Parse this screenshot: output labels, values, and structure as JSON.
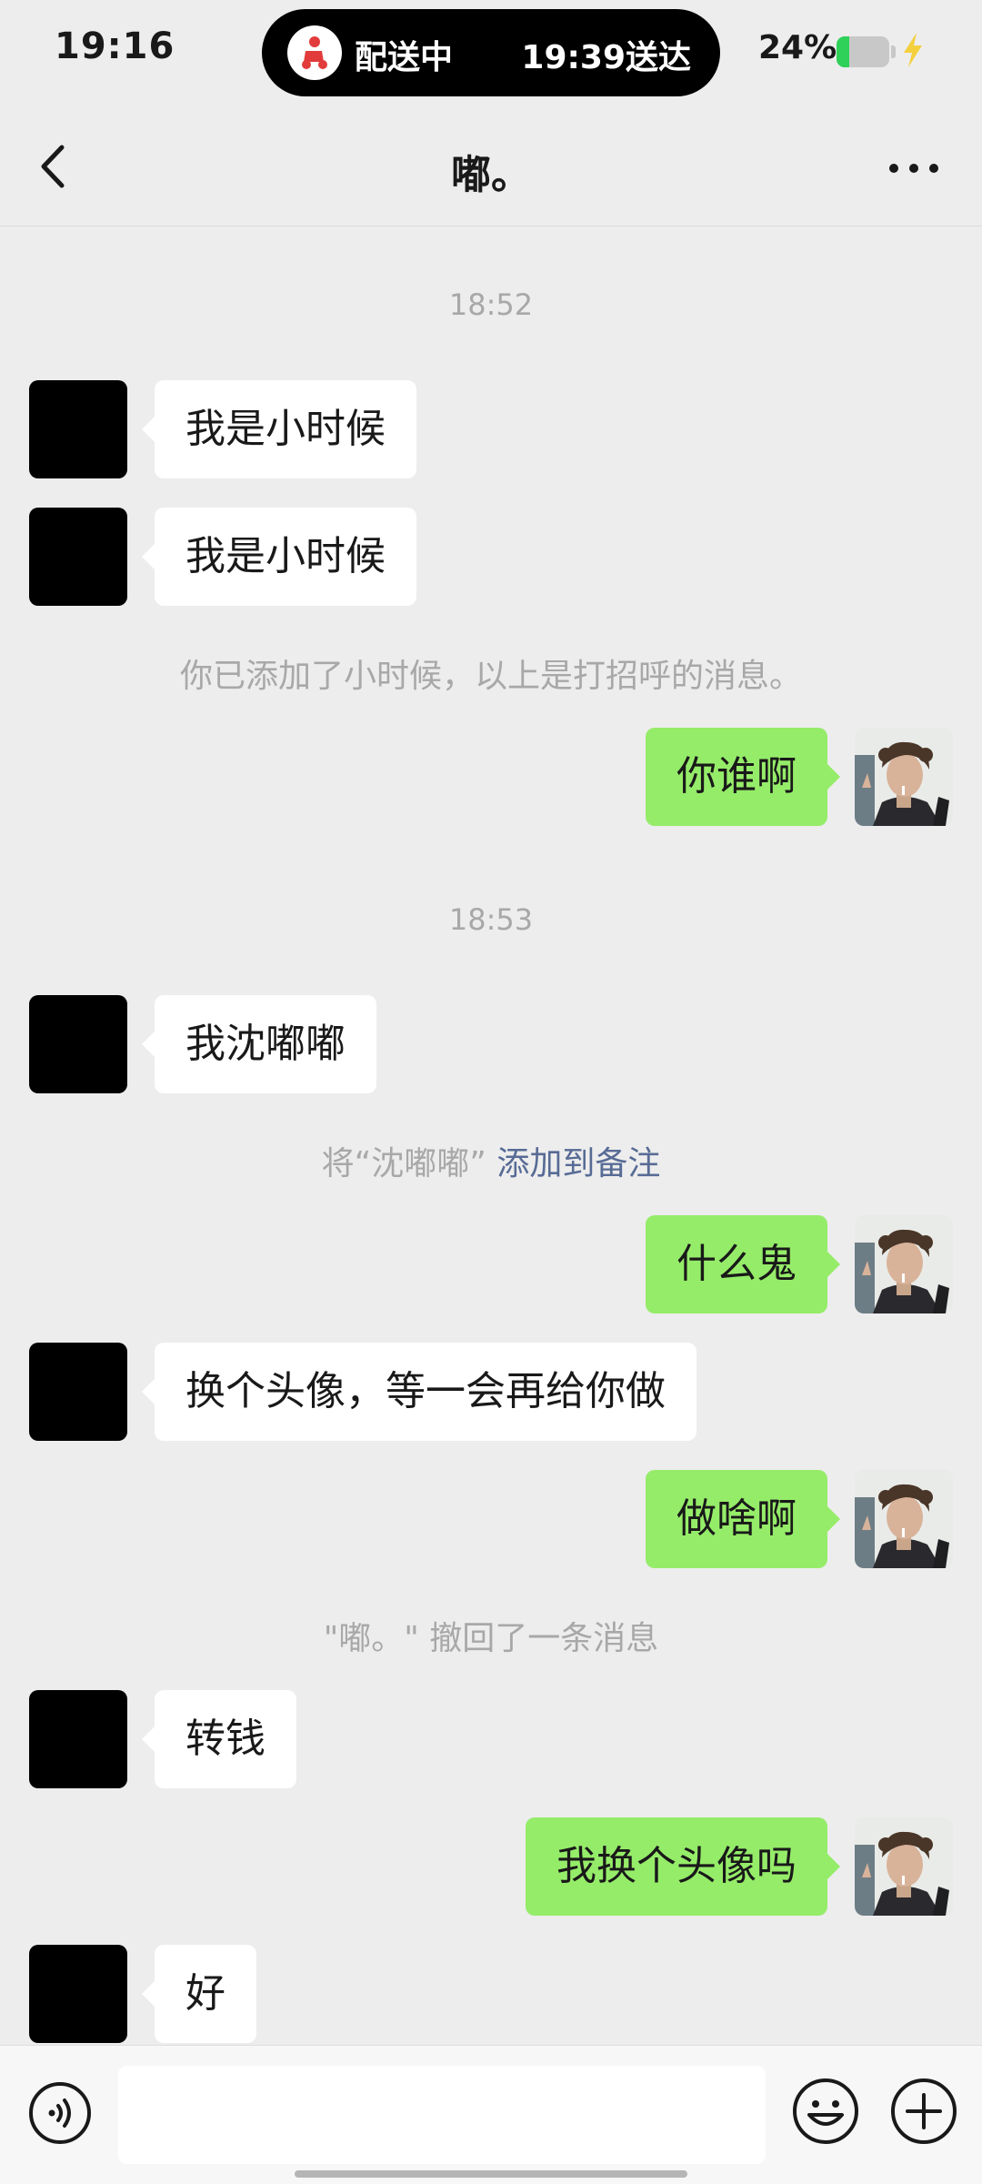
{
  "status_bar": {
    "time": "19:16",
    "delivery": {
      "status": "配送中",
      "eta": "19:39送达",
      "icon": "delivery-scooter-icon"
    },
    "battery_percent_text": "24%",
    "battery_level": 0.24,
    "battery_color": "#2fd158",
    "charging_icon": "lightning-bolt-icon"
  },
  "nav": {
    "title": "嘟。",
    "back_icon": "chevron-left-icon",
    "more_icon": "more-dots-icon"
  },
  "messages": [
    {
      "type": "time",
      "text": "18:52"
    },
    {
      "type": "in",
      "text": "我是小时候"
    },
    {
      "type": "in",
      "text": "我是小时候"
    },
    {
      "type": "system",
      "text": "你已添加了小时候，以上是打招呼的消息。"
    },
    {
      "type": "out",
      "text": "你谁啊"
    },
    {
      "type": "time",
      "text": "18:53"
    },
    {
      "type": "in",
      "text": "我沈嘟嘟"
    },
    {
      "type": "system_link",
      "text": "将“沈嘟嘟” ",
      "link": "添加到备注"
    },
    {
      "type": "out",
      "text": "什么鬼"
    },
    {
      "type": "in",
      "text": "换个头像，等一会再给你做"
    },
    {
      "type": "out",
      "text": "做啥啊"
    },
    {
      "type": "system",
      "text": "\"嘟。\" 撤回了一条消息"
    },
    {
      "type": "in",
      "text": "转钱"
    },
    {
      "type": "out",
      "text": "我换个头像吗"
    },
    {
      "type": "in",
      "text": "好"
    }
  ],
  "colors": {
    "background": "#ededed",
    "bubble_out": "#95ec69",
    "bubble_in": "#ffffff",
    "link": "#576b95"
  },
  "input_bar": {
    "voice_icon": "voice-icon",
    "input_value": "",
    "emoji_icon": "emoji-icon",
    "plus_icon": "plus-icon"
  }
}
